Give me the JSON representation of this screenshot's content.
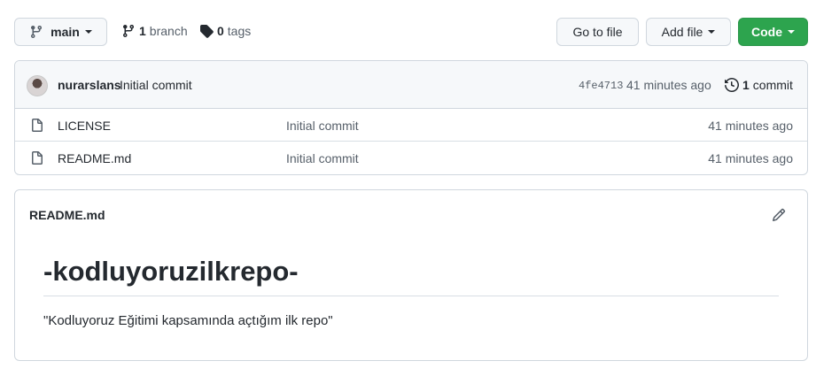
{
  "toolbar": {
    "branch_label": "main",
    "branches_count": "1",
    "branches_word": "branch",
    "tags_count": "0",
    "tags_word": "tags",
    "goto_file_label": "Go to file",
    "add_file_label": "Add file",
    "code_label": "Code"
  },
  "latest_commit": {
    "author": "nurarslans",
    "message": "Initial commit",
    "sha": "4fe4713",
    "time": "41 minutes ago",
    "count": "1",
    "count_word": "commit"
  },
  "files": [
    {
      "name": "LICENSE",
      "commit": "Initial commit",
      "age": "41 minutes ago"
    },
    {
      "name": "README.md",
      "commit": "Initial commit",
      "age": "41 minutes ago"
    }
  ],
  "readme": {
    "filename": "README.md",
    "title": "-kodluyoruzilkrepo-",
    "text": "\"Kodluyoruz Eğitimi kapsamında açtığım ilk repo\""
  },
  "colors": {
    "code_button": "#2da44e",
    "muted_text": "#57606a",
    "border": "#d0d7de"
  }
}
